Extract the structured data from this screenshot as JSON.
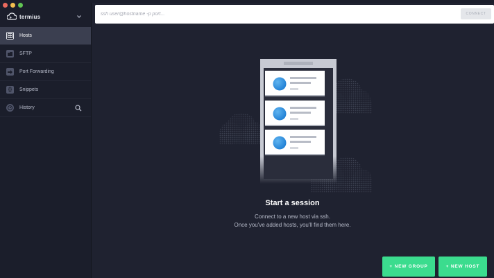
{
  "app": {
    "name": "termius"
  },
  "sidebar": {
    "items": [
      {
        "label": "Hosts",
        "icon": "hosts-icon",
        "active": true
      },
      {
        "label": "SFTP",
        "icon": "folder-icon"
      },
      {
        "label": "Port Forwarding",
        "icon": "arrow-icon"
      },
      {
        "label": "Snippets",
        "icon": "braces-icon"
      },
      {
        "label": "History",
        "icon": "clock-icon"
      }
    ]
  },
  "ssh": {
    "placeholder": "ssh user@hostname -p port...",
    "connect_label": "CONNECT"
  },
  "empty_state": {
    "title": "Start a session",
    "line1": "Connect to a new host via ssh.",
    "line2": "Once you've added hosts, you'll find them here."
  },
  "actions": {
    "new_group": "+ NEW GROUP",
    "new_host": "+ NEW HOST"
  },
  "colors": {
    "accent": "#3bdc8e",
    "background": "#1f2230",
    "sidebar": "#1b1e2b",
    "active_item": "#3b3f50"
  }
}
